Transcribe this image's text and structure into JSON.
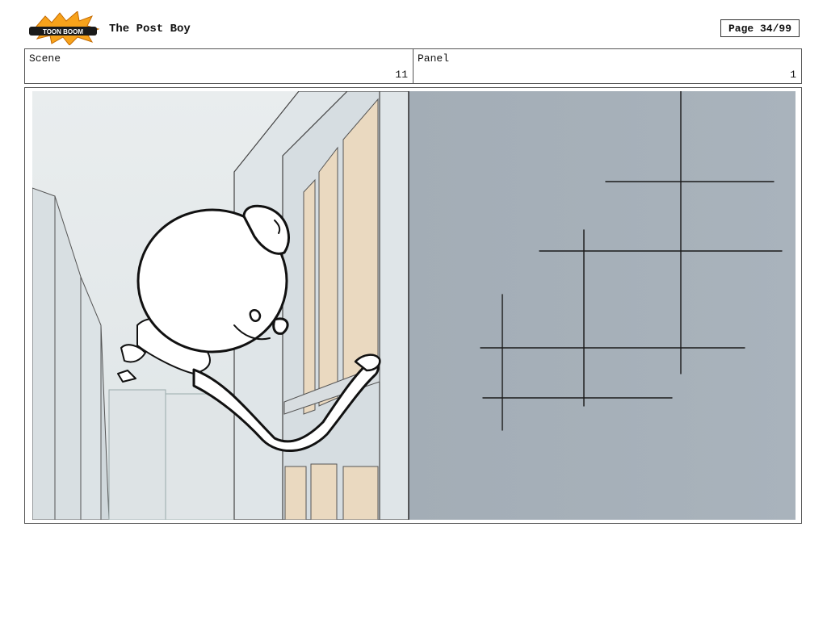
{
  "header": {
    "logo": {
      "text": "TOON BOOM",
      "icon": "toon-boom-logo-icon"
    },
    "title": "The Post Boy",
    "page": "Page 34/99"
  },
  "info": {
    "scene_label": "Scene",
    "scene_value": "11",
    "panel_label": "Panel",
    "panel_value": "1"
  },
  "artwork": {
    "description": "storyboard sketch",
    "colors": {
      "sky": "#e6eaeb",
      "building_light": "#d9e0e3",
      "wall": "#a6b0b8",
      "window_tan": "#eadfcb",
      "line": "#111111"
    }
  }
}
